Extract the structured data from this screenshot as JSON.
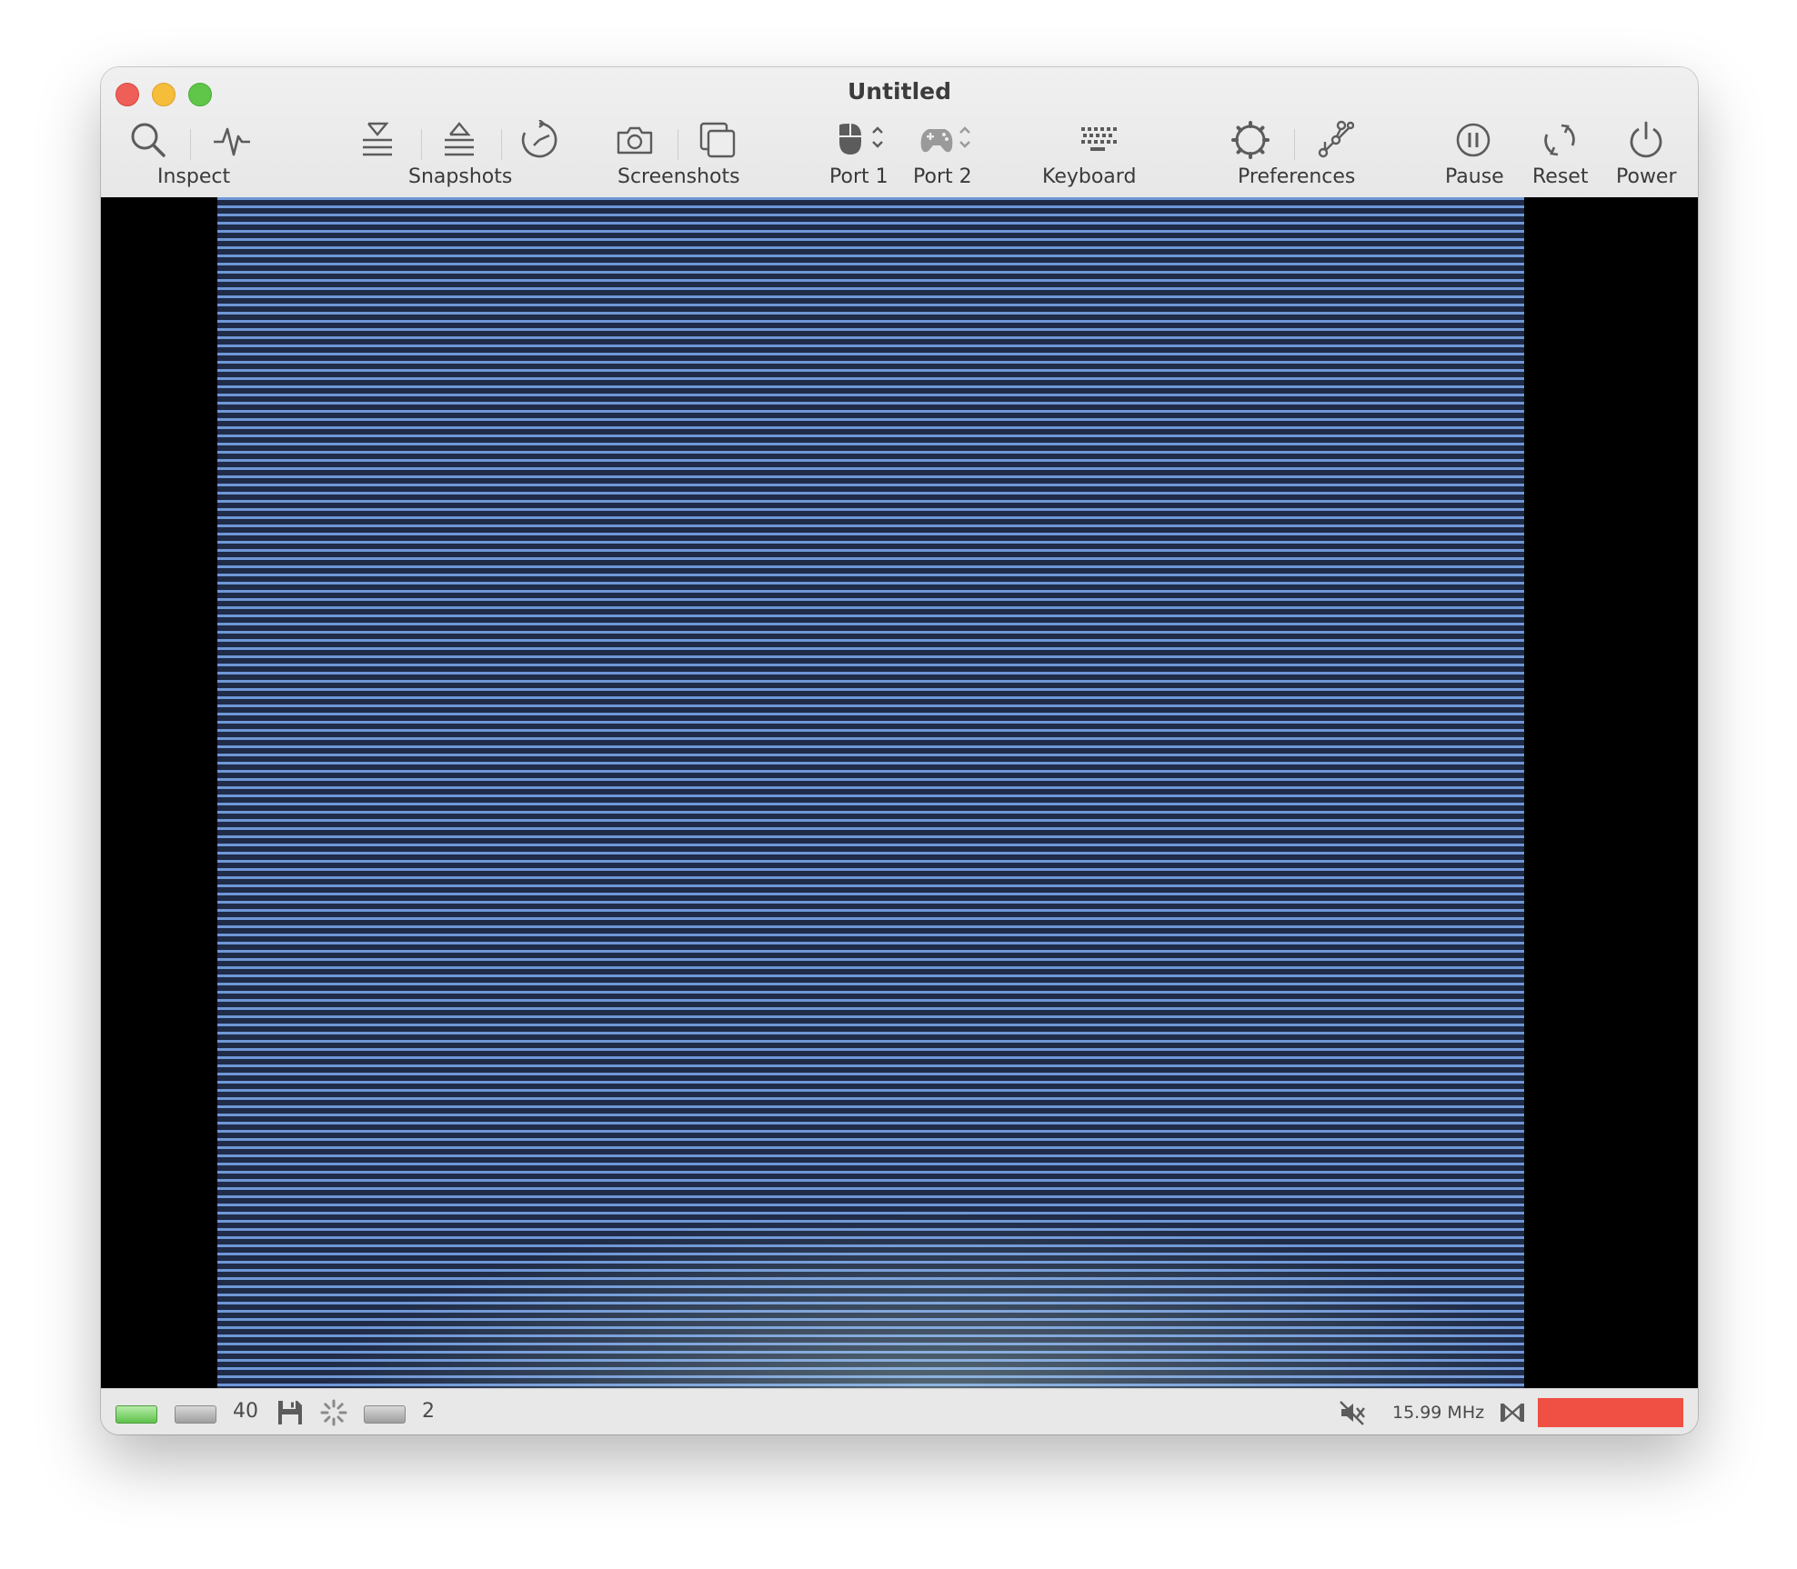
{
  "window": {
    "title": "Untitled"
  },
  "toolbar": {
    "inspect_label": "Inspect",
    "snapshots_label": "Snapshots",
    "screenshots_label": "Screenshots",
    "port1_label": "Port 1",
    "port2_label": "Port 2",
    "keyboard_label": "Keyboard",
    "preferences_label": "Preferences",
    "pause_label": "Pause",
    "reset_label": "Reset",
    "power_label": "Power"
  },
  "statusbar": {
    "track_count": "40",
    "disk_count": "2",
    "clock": "15.99 MHz"
  },
  "colors": {
    "scanline": "#6f97d6",
    "scangap": "#1f2b47",
    "led_on": "#5dc24b",
    "warp": "#ef5043"
  }
}
